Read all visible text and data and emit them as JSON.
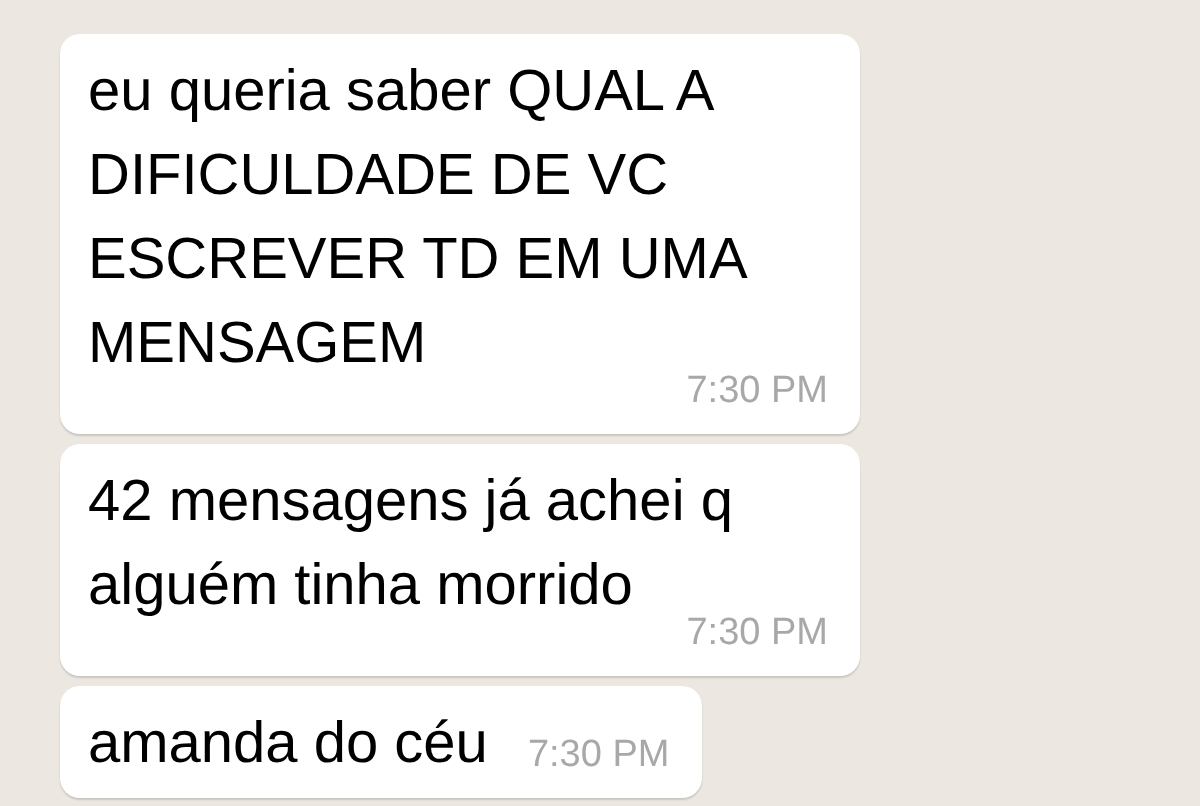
{
  "messages": [
    {
      "text": "eu queria saber QUAL A DIFICULDADE DE VC ESCREVER TD EM UMA MENSAGEM",
      "time": "7:30 PM"
    },
    {
      "text": "42 mensagens já achei q alguém tinha morrido",
      "time": "7:30 PM"
    },
    {
      "text": "amanda do céu",
      "time": "7:30 PM"
    }
  ]
}
